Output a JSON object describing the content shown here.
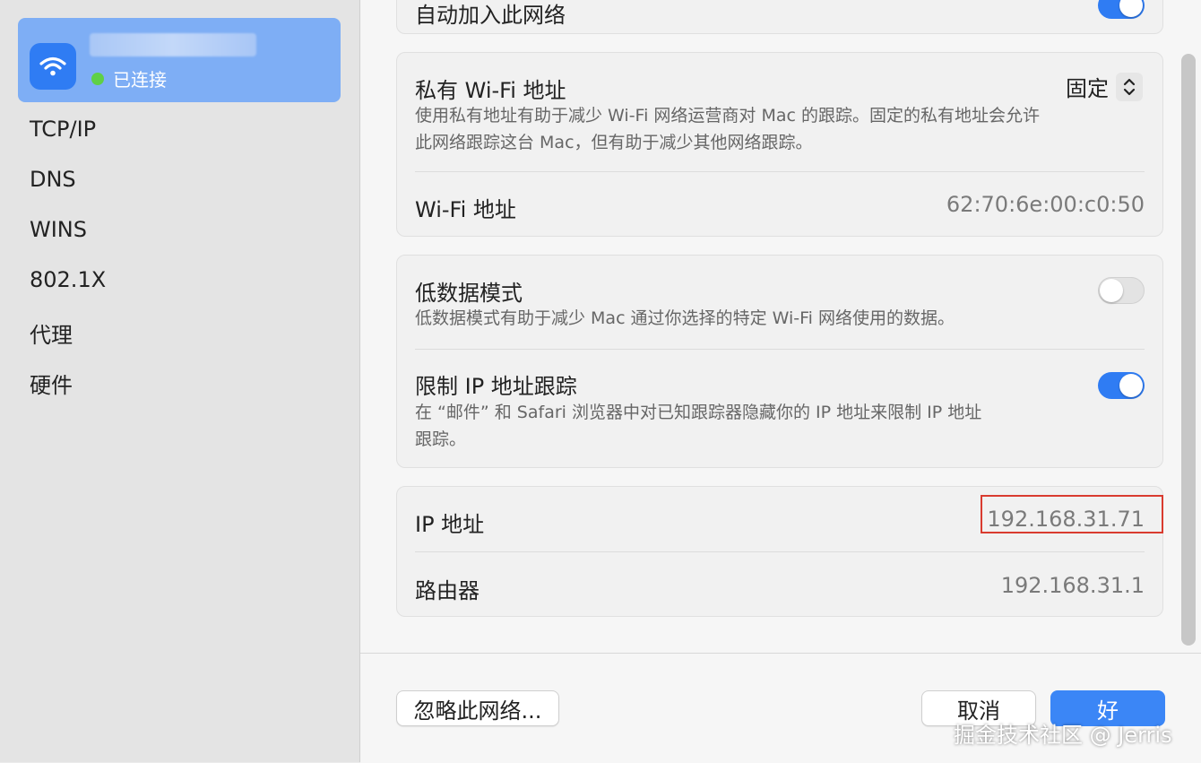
{
  "sidebar": {
    "network_status": "已连接",
    "items": [
      {
        "label": "TCP/IP"
      },
      {
        "label": "DNS"
      },
      {
        "label": "WINS"
      },
      {
        "label": "802.1X"
      },
      {
        "label": "代理"
      },
      {
        "label": "硬件"
      }
    ]
  },
  "auto_join": {
    "label": "自动加入此网络",
    "enabled": true
  },
  "private_address": {
    "title": "私有 Wi-Fi 地址",
    "description": "使用私有地址有助于减少 Wi-Fi 网络运营商对 Mac 的跟踪。固定的私有地址会允许此网络跟踪这台 Mac，但有助于减少其他网络跟踪。",
    "selected_option": "固定",
    "wifi_address_label": "Wi-Fi 地址",
    "wifi_address_value": "62:70:6e:00:c0:50"
  },
  "low_data": {
    "title": "低数据模式",
    "description": "低数据模式有助于减少 Mac 通过你选择的特定 Wi-Fi 网络使用的数据。",
    "enabled": false
  },
  "limit_ip": {
    "title": "限制 IP 地址跟踪",
    "description": "在 “邮件” 和 Safari 浏览器中对已知跟踪器隐藏你的 IP 地址来限制 IP 地址跟踪。",
    "enabled": true
  },
  "ip_info": {
    "ip_label": "IP 地址",
    "ip_value": "192.168.31.71",
    "router_label": "路由器",
    "router_value": "192.168.31.1"
  },
  "footer": {
    "forget_label": "忽略此网络...",
    "cancel_label": "取消",
    "ok_label": "好"
  },
  "watermark": "掘金技术社区 @ Jerris",
  "colors": {
    "accent": "#2f7cf3",
    "highlight": "#d93b2f",
    "connected": "#5fd046"
  }
}
